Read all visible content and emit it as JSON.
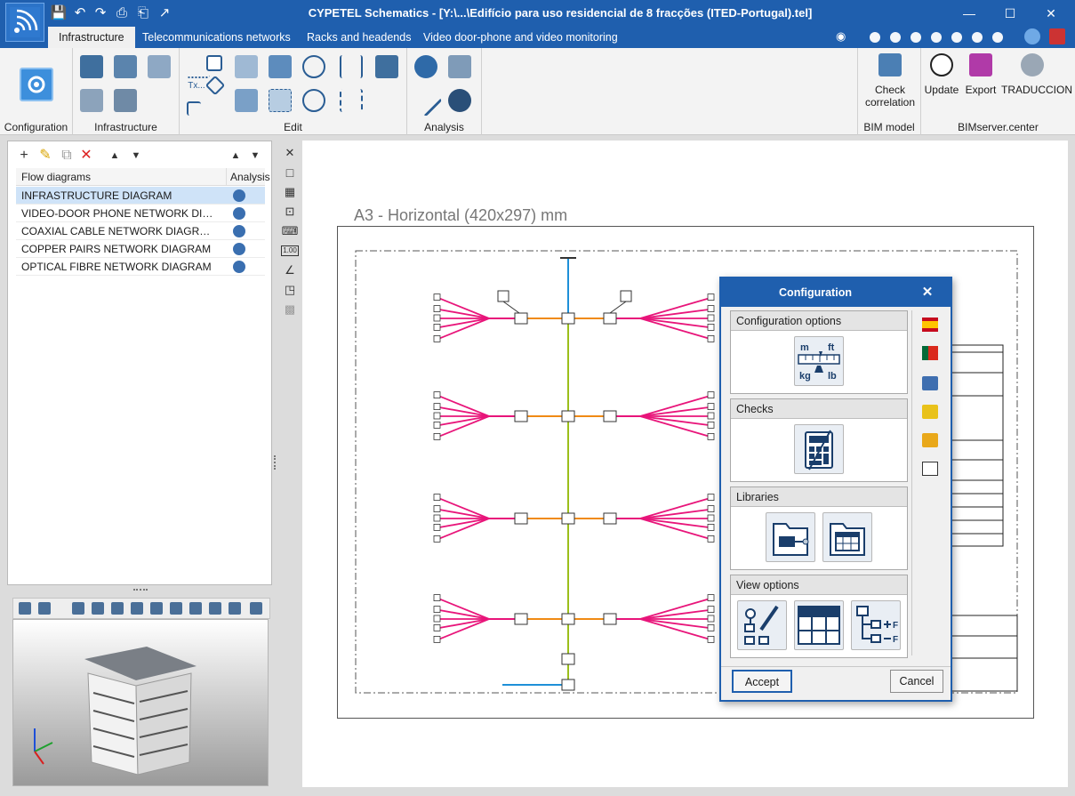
{
  "window": {
    "title": "CYPETEL Schematics - [Y:\\...\\Edifício para uso residencial de 8 fracções (ITED-Portugal).tel]",
    "minimize": "—",
    "maximize": "☐",
    "close": "✕"
  },
  "tabs": [
    "Infrastructure",
    "Telecommunications networks",
    "Racks and headends",
    "Video door-phone and video monitoring"
  ],
  "ribbon": {
    "groups": {
      "configuration": "Configuration",
      "infrastructure": "Infrastructure",
      "edit": "Edit",
      "analysis": "Analysis",
      "bim_model": "BIM model",
      "bimserver": "BIMserver.center"
    },
    "buttons": {
      "check_correlation": "Check correlation",
      "update": "Update",
      "export": "Export",
      "traduccion": "TRADUCCION",
      "text_tool": "Tx..."
    }
  },
  "flow_panel": {
    "col_name": "Flow diagrams",
    "col_analysis": "Analysis",
    "rows": [
      "INFRASTRUCTURE DIAGRAM",
      "VIDEO-DOOR PHONE NETWORK DIAG...",
      "COAXIAL CABLE NETWORK DIAGRAM",
      "COPPER PAIRS NETWORK DIAGRAM",
      "OPTICAL FIBRE NETWORK DIAGRAM"
    ],
    "selected_index": 0
  },
  "vstrip": {
    "scale_label": "1.00"
  },
  "sheet": {
    "title": "A3 - Horizontal (420x297) mm"
  },
  "dialog": {
    "title": "Configuration",
    "sections": {
      "config_options": "Configuration options",
      "checks": "Checks",
      "libraries": "Libraries",
      "view_options": "View options"
    },
    "units": {
      "m": "m",
      "ft": "ft",
      "kg": "kg",
      "lb": "lb"
    },
    "accept": "Accept",
    "cancel": "Cancel"
  },
  "colors": {
    "titlebar": "#1f5fae",
    "riser": "#9bbf1b",
    "branch": "#e8157a",
    "trunk": "#f08a14",
    "antenna": "#1e90d8"
  }
}
